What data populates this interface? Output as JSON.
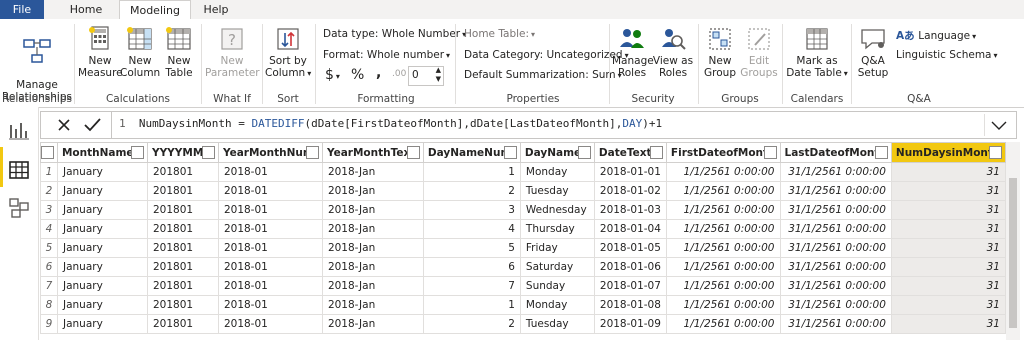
{
  "tabs": [
    "File",
    "Home",
    "Modeling",
    "Help"
  ],
  "ribbon": {
    "relationships": {
      "manage": "Manage\nRelationships",
      "group": "Relationships"
    },
    "calculations": {
      "new_measure": "New\nMeasure",
      "new_column": "New\nColumn",
      "new_table": "New\nTable",
      "group": "Calculations"
    },
    "whatif": {
      "new_parameter": "New\nParameter",
      "group": "What If"
    },
    "sort": {
      "sort_by": "Sort by\nColumn",
      "group": "Sort"
    },
    "formatting": {
      "data_type": "Data type: Whole Number",
      "format": "Format: Whole number",
      "currency": "$",
      "percent": "%",
      "comma": ",",
      "decimals_value": "0",
      "group": "Formatting"
    },
    "properties": {
      "home_table": "Home Table:",
      "data_category": "Data Category: Uncategorized",
      "default_summarization": "Default Summarization: Sum",
      "group": "Properties"
    },
    "security": {
      "manage_roles": "Manage\nRoles",
      "view_as": "View as\nRoles",
      "group": "Security"
    },
    "groups": {
      "new_group": "New\nGroup",
      "edit_groups": "Edit\nGroups",
      "group": "Groups"
    },
    "calendars": {
      "mark_as": "Mark as\nDate Table",
      "group": "Calendars"
    },
    "qa": {
      "setup": "Q&A\nSetup",
      "language": "Language",
      "linguistic": "Linguistic Schema",
      "group": "Q&A"
    }
  },
  "formula": {
    "line": "1",
    "p1": "NumDaysinMonth = ",
    "kw1": "DATEDIFF",
    "p2": "(dDate[FirstDateofMonth],dDate[LastDateofMonth],",
    "kw2": "DAY",
    "p3": ")+1"
  },
  "table": {
    "columns": [
      "MonthName",
      "YYYYMM",
      "YearMonthNum",
      "YearMonthText",
      "DayNameNum",
      "DayName",
      "DateText",
      "FirstDateofMonth",
      "LastDateofMonth",
      "NumDaysinMonth"
    ],
    "rows": [
      [
        "1",
        "January",
        "201801",
        "2018-01",
        "2018-Jan",
        "1",
        "Monday",
        "2018-01-01",
        "1/1/2561 0:00:00",
        "31/1/2561 0:00:00",
        "31"
      ],
      [
        "2",
        "January",
        "201801",
        "2018-01",
        "2018-Jan",
        "2",
        "Tuesday",
        "2018-01-02",
        "1/1/2561 0:00:00",
        "31/1/2561 0:00:00",
        "31"
      ],
      [
        "3",
        "January",
        "201801",
        "2018-01",
        "2018-Jan",
        "3",
        "Wednesday",
        "2018-01-03",
        "1/1/2561 0:00:00",
        "31/1/2561 0:00:00",
        "31"
      ],
      [
        "4",
        "January",
        "201801",
        "2018-01",
        "2018-Jan",
        "4",
        "Thursday",
        "2018-01-04",
        "1/1/2561 0:00:00",
        "31/1/2561 0:00:00",
        "31"
      ],
      [
        "5",
        "January",
        "201801",
        "2018-01",
        "2018-Jan",
        "5",
        "Friday",
        "2018-01-05",
        "1/1/2561 0:00:00",
        "31/1/2561 0:00:00",
        "31"
      ],
      [
        "6",
        "January",
        "201801",
        "2018-01",
        "2018-Jan",
        "6",
        "Saturday",
        "2018-01-06",
        "1/1/2561 0:00:00",
        "31/1/2561 0:00:00",
        "31"
      ],
      [
        "7",
        "January",
        "201801",
        "2018-01",
        "2018-Jan",
        "7",
        "Sunday",
        "2018-01-07",
        "1/1/2561 0:00:00",
        "31/1/2561 0:00:00",
        "31"
      ],
      [
        "8",
        "January",
        "201801",
        "2018-01",
        "2018-Jan",
        "1",
        "Monday",
        "2018-01-08",
        "1/1/2561 0:00:00",
        "31/1/2561 0:00:00",
        "31"
      ],
      [
        "9",
        "January",
        "201801",
        "2018-01",
        "2018-Jan",
        "2",
        "Tuesday",
        "2018-01-09",
        "1/1/2561 0:00:00",
        "31/1/2561 0:00:00",
        "31"
      ]
    ]
  },
  "colors": {
    "accent": "#f2c811",
    "file_tab": "#2b579a"
  }
}
